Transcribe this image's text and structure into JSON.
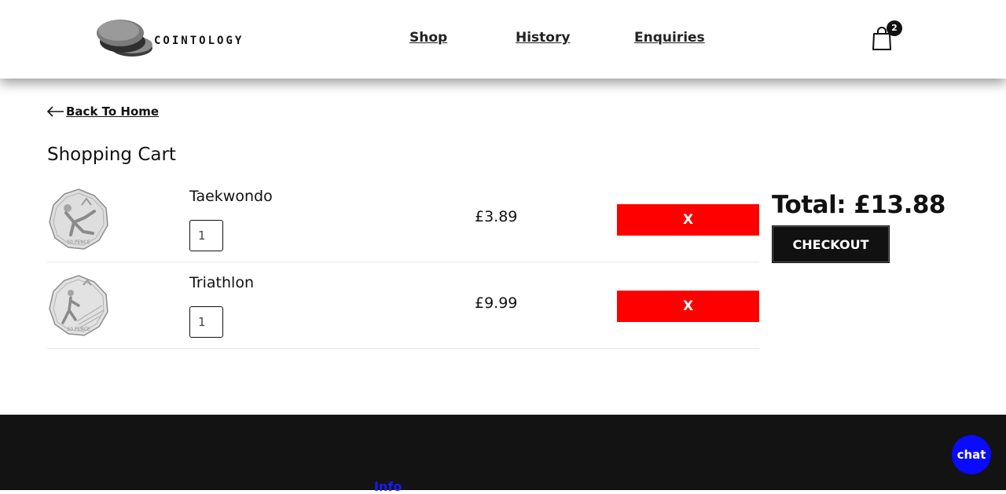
{
  "brand": {
    "name": "COINTOLOGY"
  },
  "nav": {
    "items": [
      "Shop",
      "History",
      "Enquiries"
    ]
  },
  "cart": {
    "count": "2"
  },
  "back_link": {
    "label": "Back To Home"
  },
  "page": {
    "title": "Shopping Cart"
  },
  "items": [
    {
      "name": "Taekwondo",
      "quantity": "1",
      "price": "£3.89",
      "remove_label": "X",
      "coin_icon": "taekwondo-coin"
    },
    {
      "name": "Triathlon",
      "quantity": "1",
      "price": "£9.99",
      "remove_label": "X",
      "coin_icon": "triathlon-coin"
    }
  ],
  "summary": {
    "total": "Total: £13.88",
    "checkout_label": "CHECKOUT"
  },
  "footer": {
    "info_label": "Info"
  },
  "chat": {
    "label": "chat"
  },
  "colors": {
    "remove": "#ff0000",
    "chat": "#0a0aff",
    "footer": "#131313",
    "checkout": "#111111"
  }
}
